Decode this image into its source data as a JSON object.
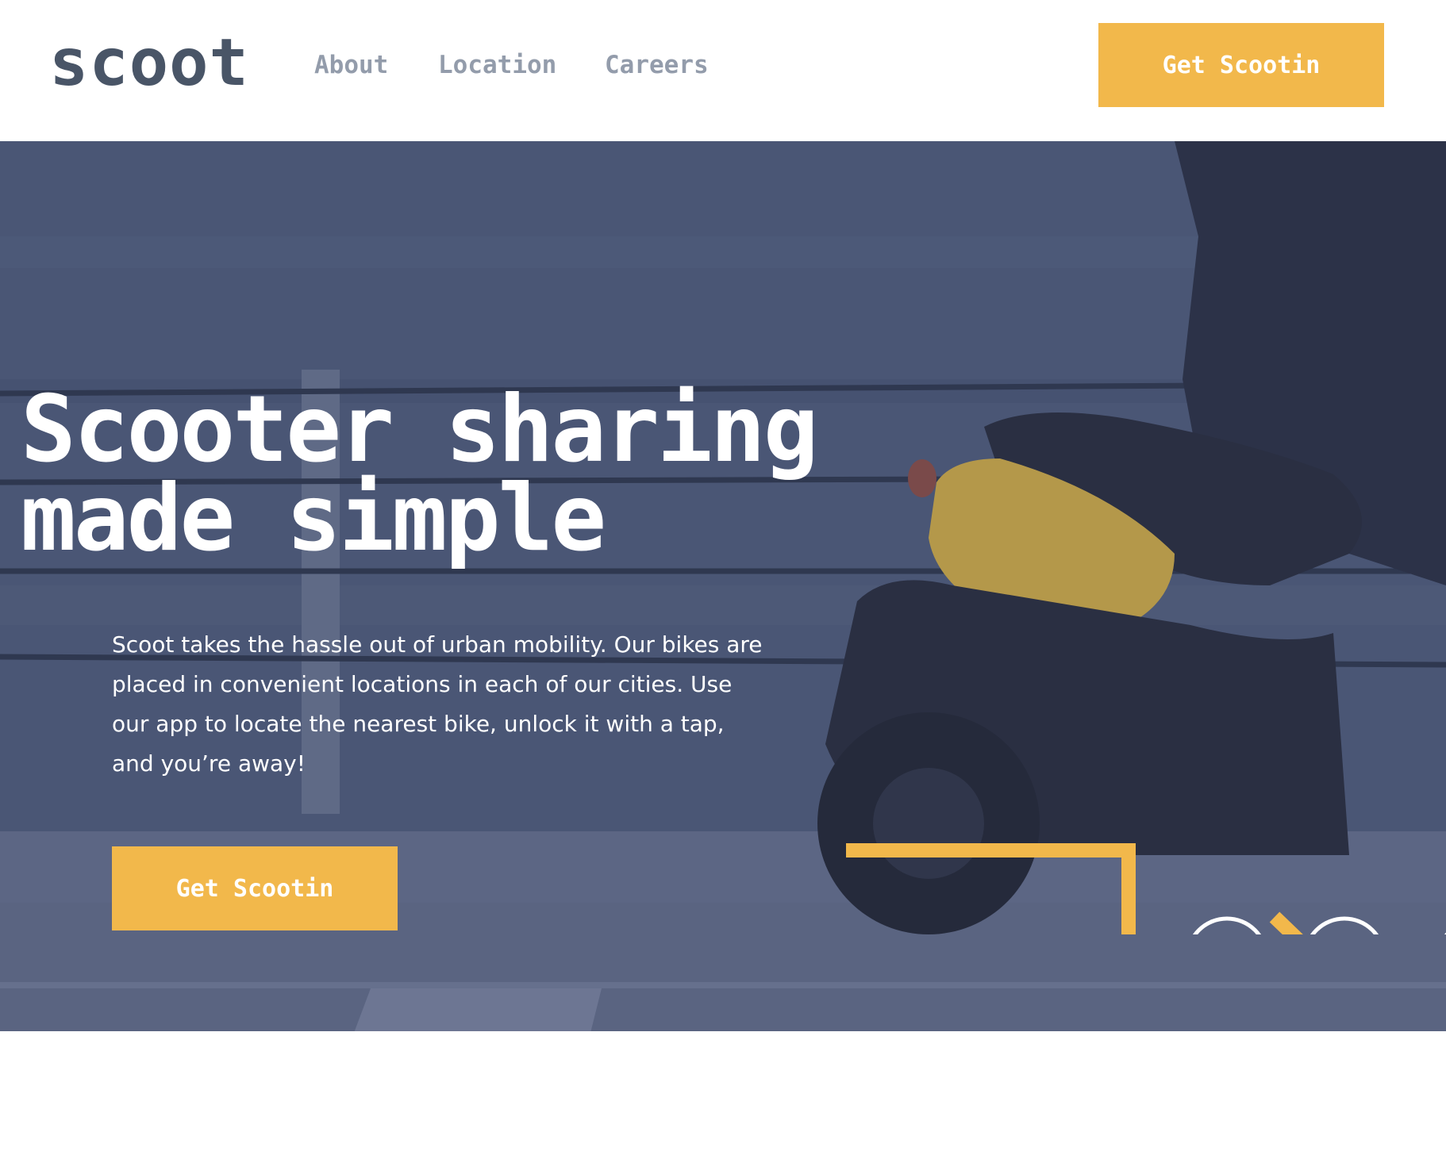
{
  "brand": {
    "logo_text": "scoot",
    "accent_color": "#f2b84b",
    "text_dark": "#495567",
    "nav_color": "#939cab",
    "hero_overlay": "#3c4663"
  },
  "nav": {
    "items": [
      {
        "label": "About"
      },
      {
        "label": "Location"
      },
      {
        "label": "Careers"
      }
    ]
  },
  "header": {
    "cta_label": "Get Scootin"
  },
  "hero": {
    "title_line1": "Scooter sharing",
    "title_line2": "made simple",
    "description": "Scoot takes the hassle out of urban mobility. Our bikes are placed in convenient locations in each of our cities. Use our app to locate the nearest bike, unlock it with a tap, and you’re away!",
    "cta_label": "Get Scootin",
    "background_image": "person-on-yellow-scooter-by-the-sea",
    "decoration_icon": "arrow-path-with-circles"
  }
}
